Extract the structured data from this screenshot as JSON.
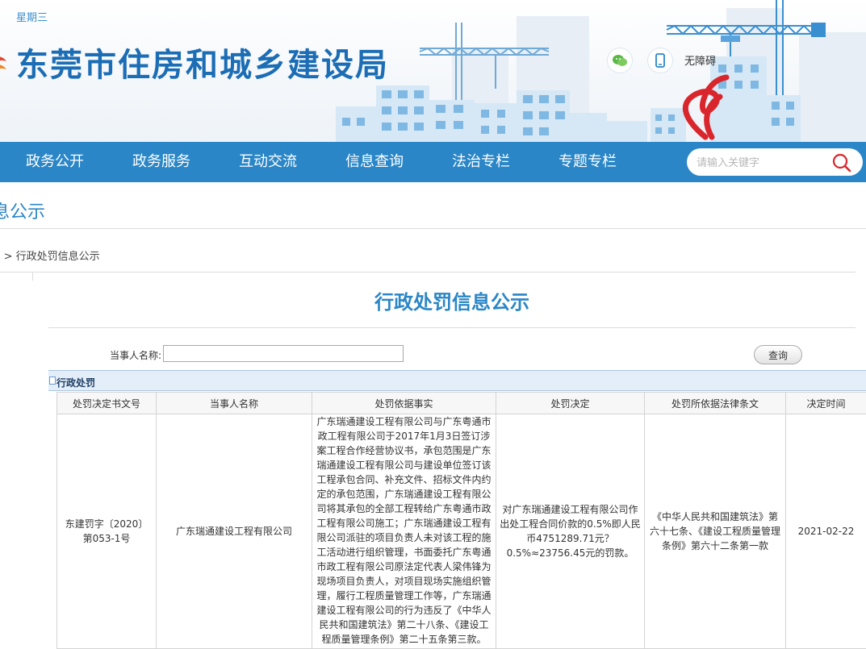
{
  "header": {
    "weekday": "星期三",
    "site_title": "东莞市住房和城乡建设局",
    "accessibility_label": "无障碍"
  },
  "nav": {
    "items": [
      {
        "label": "政务公开"
      },
      {
        "label": "政务服务"
      },
      {
        "label": "互动交流"
      },
      {
        "label": "信息查询"
      },
      {
        "label": "法治专栏"
      },
      {
        "label": "专题专栏"
      }
    ],
    "search_placeholder": "请输入关键字"
  },
  "page": {
    "section_title": "息公示",
    "breadcrumb": "` > 行政处罚信息公示",
    "main_title": "行政处罚信息公示"
  },
  "filter": {
    "party_label": "当事人名称:",
    "party_value": "",
    "query_button": "查询"
  },
  "panel": {
    "title": "行政处罚"
  },
  "table": {
    "headers": [
      "处罚决定书文号",
      "当事人名称",
      "处罚依据事实",
      "处罚决定",
      "处罚所依据法律条文",
      "决定时间"
    ],
    "rows": [
      {
        "doc_no": "东建罚字〔2020〕第053-1号",
        "party": "广东瑞通建设工程有限公司",
        "facts": "广东瑞通建设工程有限公司与广东粤通市政工程有限公司于2017年1月3日签订涉案工程合作经营协议书，承包范围是广东瑞通建设工程有限公司与建设单位签订该工程承包合同、补充文件、招标文件内约定的承包范围，广东瑞通建设工程有限公司将其承包的全部工程转给广东粤通市政工程有限公司施工；广东瑞通建设工程有限公司派驻的项目负责人未对该工程的施工活动进行组织管理，书面委托广东粤通市政工程有限公司原法定代表人梁伟锋为现场项目负责人，对项目现场实施组织管理，履行工程质量管理工作等，广东瑞通建设工程有限公司的行为违反了《中华人民共和国建筑法》第二十八条、《建设工程质量管理条例》第二十五条第三款。",
        "decision": "对广东瑞通建设工程有限公司作出处工程合同价款的0.5%即人民币4751289.71元？0.5%≈23756.45元的罚款。",
        "law": "《中华人民共和国建筑法》第六十七条、《建设工程质量管理条例》第六十二条第一款",
        "date": "2021-02-22"
      }
    ]
  },
  "colors": {
    "brand_blue": "#1b6db5",
    "nav_bg": "#2a86c7",
    "accent_red": "#d9262c",
    "panel_bg": "#e3eef9"
  },
  "icons": [
    "wechat-icon",
    "mobile-icon",
    "search-icon",
    "crane-illustration",
    "sculpture-illustration",
    "logo-icon"
  ]
}
